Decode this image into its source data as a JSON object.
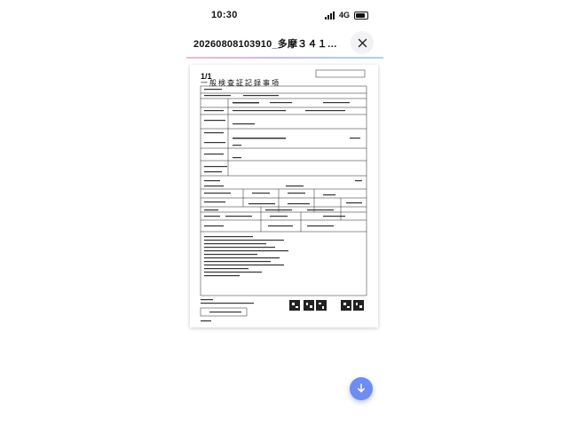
{
  "status_bar": {
    "time": "10:30",
    "network": "4G"
  },
  "header": {
    "title": "20260808103910_多摩３４１つ７０..."
  },
  "document": {
    "page_indicator": "1/1",
    "title": "一般検査証記録事項"
  },
  "icons": {
    "close": "close-icon",
    "download": "download-icon",
    "signal": "signal-icon",
    "battery": "battery-icon"
  },
  "colors": {
    "accent": "#6f8cf0",
    "progress_start": "#f6b8c8",
    "progress_end": "#9fd8f5"
  }
}
